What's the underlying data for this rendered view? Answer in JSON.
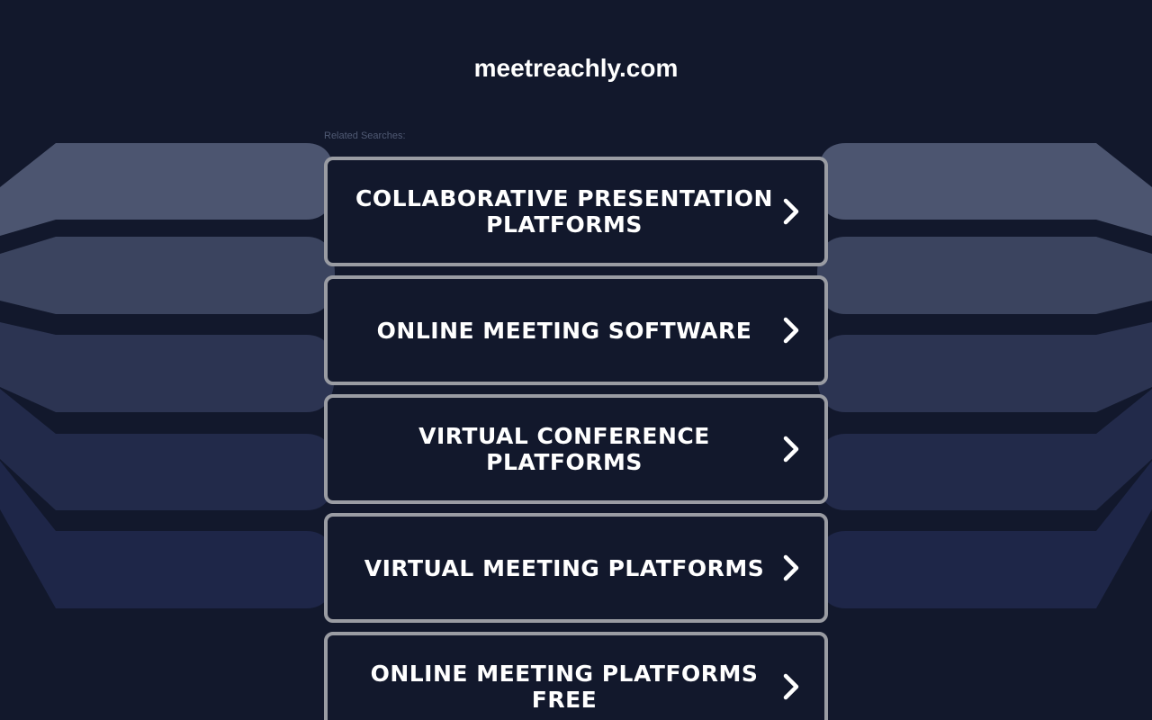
{
  "page": {
    "domain": "meetreachly.com",
    "related_searches_label": "Related Searches:"
  },
  "links": [
    {
      "label": "COLLABORATIVE PRESENTATION PLATFORMS",
      "icon": "chevron-right-icon"
    },
    {
      "label": "ONLINE MEETING SOFTWARE",
      "icon": "chevron-right-icon"
    },
    {
      "label": "VIRTUAL CONFERENCE PLATFORMS",
      "icon": "chevron-right-icon"
    },
    {
      "label": "VIRTUAL MEETING PLATFORMS",
      "icon": "chevron-right-icon"
    },
    {
      "label": "ONLINE MEETING PLATFORMS FREE",
      "icon": "chevron-right-icon"
    }
  ],
  "colors": {
    "background": "#12182c",
    "card_border": "#9a9ca3",
    "text": "#ffffff",
    "label": "#505a74"
  }
}
